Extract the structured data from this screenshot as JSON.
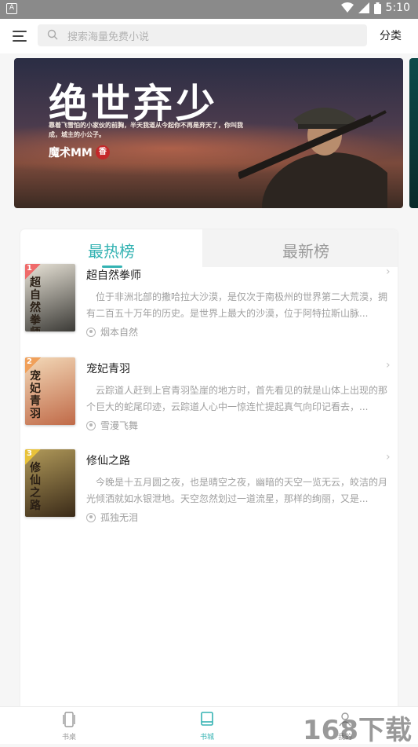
{
  "status_bar": {
    "time": "5:10",
    "app_icon_letter": "A"
  },
  "header": {
    "search_placeholder": "搜索海量免费小说",
    "category_label": "分类"
  },
  "banner": {
    "title": "绝世弃少",
    "subtitle": "靠着飞雪怕的小家伙的前胸，半天我道从今起你不再是弃天了，你叫我成，城主的小公子。",
    "author": "魔术MM",
    "badge": "香"
  },
  "tabs": [
    {
      "label": "最热榜",
      "active": true
    },
    {
      "label": "最新榜",
      "active": false
    }
  ],
  "books": [
    {
      "rank": "1",
      "rank_color": "#ef6a6a",
      "title": "超自然拳师",
      "cover_text": "超自然拳师",
      "cover_colors": [
        "#e9e4d8",
        "#3b3a36"
      ],
      "description": "位于非洲北部的撒哈拉大沙漠，是仅次于南极州的世界第二大荒漠，拥有二百五十万年的历史。是世界上最大的沙漠，位于阿特拉斯山脉...",
      "author": "烟本自然"
    },
    {
      "rank": "2",
      "rank_color": "#f0a05a",
      "title": "宠妃青羽",
      "cover_text": "宠妃青羽",
      "cover_colors": [
        "#f3d9b8",
        "#c06a48"
      ],
      "description": "云踪道人赶到上官青羽坠崖的地方时，首先看见的就是山体上出现的那个巨大的蛇尾印迹，云踪道人心中一惊连忙提起真气向印记看去，...",
      "author": "雪漫飞舞"
    },
    {
      "rank": "3",
      "rank_color": "#e8c23a",
      "title": "修仙之路",
      "cover_text": "修仙之路",
      "cover_colors": [
        "#b19a5a",
        "#3a2a18"
      ],
      "description": "今晚是十五月圆之夜，也是晴空之夜，幽暗的天空一览无云，皎洁的月光倾洒就如水银泄地。天空忽然划过一道流星，那样的绚丽，又是...",
      "author": "孤独无泪"
    }
  ],
  "bottom_nav": [
    {
      "label": "书桌",
      "active": false
    },
    {
      "label": "书城",
      "active": true
    },
    {
      "label": "我的",
      "active": false
    }
  ],
  "watermark": "168下载",
  "colors": {
    "accent": "#35b3b3",
    "text_primary": "#222222",
    "text_muted": "#a0a0a0"
  }
}
